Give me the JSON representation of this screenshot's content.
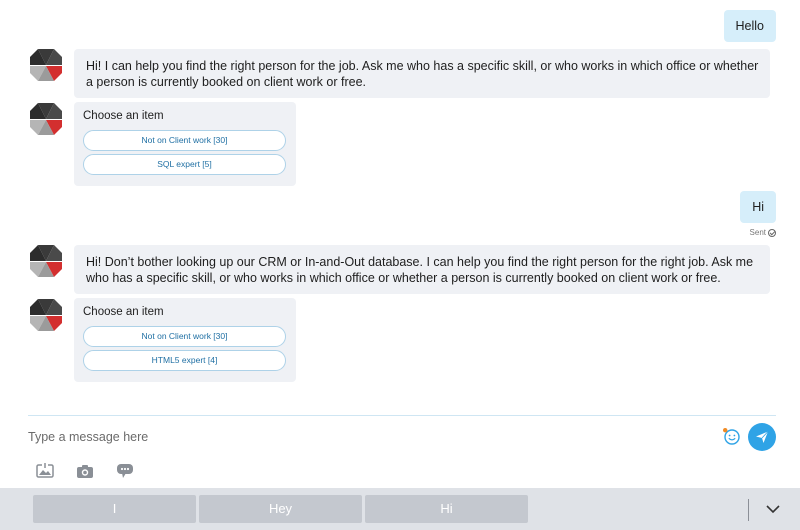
{
  "messages": [
    {
      "role": "user",
      "text": "Hello"
    },
    {
      "role": "bot",
      "text": "Hi! I can help you find the right person for the job. Ask me who has a specific skill, or who works in which office or whether a person is currently booked on client work or free."
    },
    {
      "role": "bot-card",
      "title": "Choose an item",
      "options": [
        "Not on Client work [30]",
        "SQL expert [5]"
      ]
    },
    {
      "role": "user",
      "text": "Hi",
      "status": "Sent"
    },
    {
      "role": "bot",
      "text": "Hi! Don’t bother looking up our CRM or In-and-Out database. I can help you find the right person for the right job. Ask me who has a specific skill, or who works in which office or whether a person is currently booked on client work or free."
    },
    {
      "role": "bot-card",
      "title": "Choose an item",
      "options": [
        "Not on Client work [30]",
        "HTML5 expert [4]"
      ]
    }
  ],
  "composer": {
    "placeholder": "Type a message here"
  },
  "toolbar": {
    "icons": [
      "image-gallery-icon",
      "camera-icon",
      "chat-bubble-icon"
    ]
  },
  "suggestions": [
    "I",
    "Hey",
    "Hi"
  ],
  "colors": {
    "accent": "#2fa3e6",
    "user_bubble": "#d6eefa",
    "bot_bubble": "#eff1f5",
    "avatar_red": "#d32f2f",
    "avatar_dark": "#3a3a3a"
  }
}
